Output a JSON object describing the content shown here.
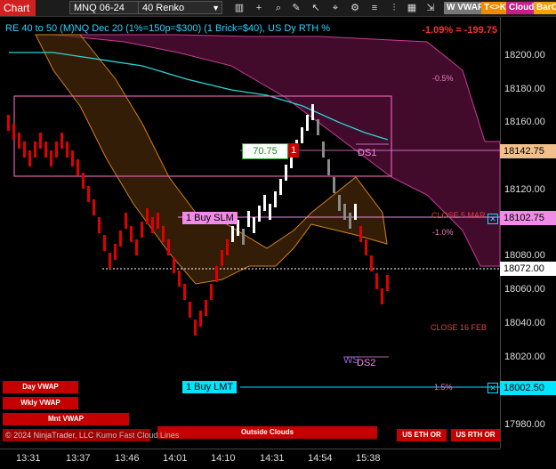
{
  "toolbar": {
    "chart_tab": "Chart",
    "instrument": "MNQ 06-24",
    "bar_type": "40 Renko",
    "btn_wvwap": "W VWAP",
    "btn_tk": "T<>K",
    "btn_cloud": "Cloud",
    "btn_barco": "BarCo"
  },
  "chart_title": "RE 40 to 50 (M)NQ Dec 20 (1%=150p=$300) (1 Brick=$40), US Dy RTH %",
  "pnl": "-1.09% = -199.75",
  "price_axis": {
    "ticks": [
      "18200.00",
      "18180.00",
      "18160.00",
      "18120.00",
      "18080.00",
      "18060.00",
      "18040.00",
      "18020.00",
      "17980.00"
    ],
    "tag_top": "18142.75",
    "tag_mid": "18102.75",
    "tag_current": "18072.00",
    "tag_bottom": "18002.50"
  },
  "time_axis": [
    "13:31",
    "13:37",
    "13:46",
    "14:01",
    "14:10",
    "14:31",
    "14:54",
    "15:38"
  ],
  "labels": {
    "ds1": "DS1",
    "ds2": "DS2",
    "ws": "WS",
    "pct_neg05": "-0.5%",
    "close5": "CLOSE 5 MAR",
    "pct_neg10": "-1.0%",
    "close16": "CLOSE 16 FEB",
    "pct_15": "1.5%",
    "stop_value": "70.75",
    "stop_qty": "1"
  },
  "orders": {
    "buy_slm": "1 Buy SLM",
    "buy_lmt": "1 Buy LMT",
    "close_x": "✕"
  },
  "bottom_buttons": {
    "day_vwap": "Day VWAP",
    "wkly_vwap": "Wkly VWAP",
    "mnt_vwap": "Mnt VWAP",
    "outside_clouds": "Outside Clouds",
    "us_eth_or": "US ETH OR",
    "us_rth_or": "US RTH OR"
  },
  "copyright": "© 2024 NinjaTrader, LLC",
  "overlay_text": "Kumo Fast Cloud Lines",
  "colors": {
    "price_line": "#ffffff",
    "up_brick": "#ffffff",
    "down_brick": "#e00000",
    "cloud_pink": "#d83aa0",
    "cloud_orange": "#b8701c",
    "vwap_cyan": "#2ad4d4",
    "order_cyan": "#00e5ff",
    "order_pink": "#f08be8"
  }
}
